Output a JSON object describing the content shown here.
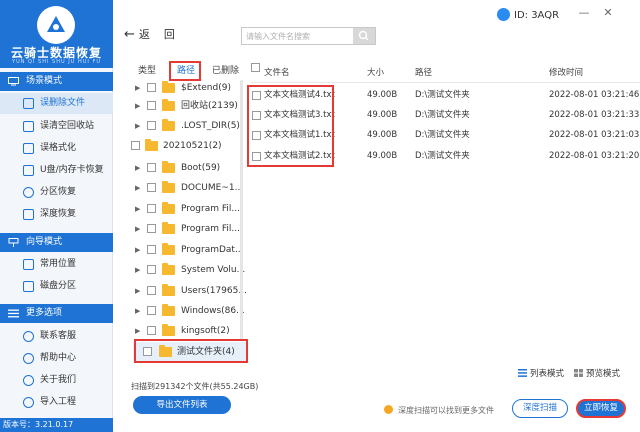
{
  "app": {
    "name": "云骑士数据恢复",
    "pinyin": "YUN QI SHI SHU JU HUI FU",
    "version": "版本号：3.21.0.17",
    "user_id": "ID: 3AQR",
    "brand_color": "#1f73d4",
    "window_buttons": {
      "minimize": "—",
      "close": "✕"
    }
  },
  "sidebar": {
    "sections": [
      {
        "title": "场景模式",
        "icon": "computer-icon",
        "items": [
          {
            "label": "误删除文件",
            "icon": "monitor-icon",
            "active": true
          },
          {
            "label": "误清空回收站",
            "icon": "trash-icon"
          },
          {
            "label": "误格式化",
            "icon": "format-icon"
          },
          {
            "label": "U盘/内存卡恢复",
            "icon": "usb-icon"
          },
          {
            "label": "分区恢复",
            "icon": "partition-icon"
          },
          {
            "label": "深度恢复",
            "icon": "deep-icon"
          }
        ]
      },
      {
        "title": "向导模式",
        "icon": "guide-icon",
        "items": [
          {
            "label": "常用位置",
            "icon": "folder-icon"
          },
          {
            "label": "磁盘分区",
            "icon": "disk-icon"
          }
        ]
      },
      {
        "title": "更多选项",
        "icon": "menu-icon",
        "items": [
          {
            "label": "联系客服",
            "icon": "service-icon"
          },
          {
            "label": "帮助中心",
            "icon": "help-icon"
          },
          {
            "label": "关于我们",
            "icon": "info-icon"
          },
          {
            "label": "导入工程",
            "icon": "import-icon"
          }
        ]
      }
    ]
  },
  "topbar": {
    "back_label": "返",
    "back_label2": "回",
    "search_placeholder": "请输入文件名搜索"
  },
  "tree": {
    "tabs": [
      "类型",
      "路径",
      "已删除"
    ],
    "active_tab": "路径",
    "rows": [
      {
        "label": "$Extend(9)"
      },
      {
        "label": "回收站(2139)"
      },
      {
        "label": ".LOST_DIR(5)"
      },
      {
        "label": "20210521(2)",
        "sub": true
      },
      {
        "label": "Boot(59)"
      },
      {
        "label": "DOCUME~1..."
      },
      {
        "label": "Program Fil..."
      },
      {
        "label": "Program Fil..."
      },
      {
        "label": "ProgramDat..."
      },
      {
        "label": "System Volu..."
      },
      {
        "label": "Users(17965..."
      },
      {
        "label": "Windows(86..."
      },
      {
        "label": "kingsoft(2)"
      },
      {
        "label": "测试文件夹(4)",
        "selected": true,
        "sub": true
      }
    ]
  },
  "table": {
    "headers": {
      "name": "文件名",
      "size": "大小",
      "path": "路径",
      "mtime": "修改时间"
    },
    "rows": [
      {
        "name": "文本文档测试4.txt",
        "size": "49.00B",
        "path": "D:\\测试文件夹",
        "mtime": "2022-08-01 03:21:46"
      },
      {
        "name": "文本文档测试3.txt",
        "size": "49.00B",
        "path": "D:\\测试文件夹",
        "mtime": "2022-08-01 03:21:33"
      },
      {
        "name": "文本文档测试1.txt",
        "size": "49.00B",
        "path": "D:\\测试文件夹",
        "mtime": "2022-08-01 03:21:03"
      },
      {
        "name": "文本文档测试2.txt",
        "size": "49.00B",
        "path": "D:\\测试文件夹",
        "mtime": "2022-08-01 03:21:20"
      }
    ]
  },
  "bottom": {
    "scan_summary": "扫描到291342个文件(共55.24GB)",
    "export_label": "导出文件列表",
    "list_mode": "列表模式",
    "preview_mode": "预览模式",
    "hint": "深度扫描可以找到更多文件",
    "deep_scan": "深度扫描",
    "recover": "立即恢复"
  }
}
